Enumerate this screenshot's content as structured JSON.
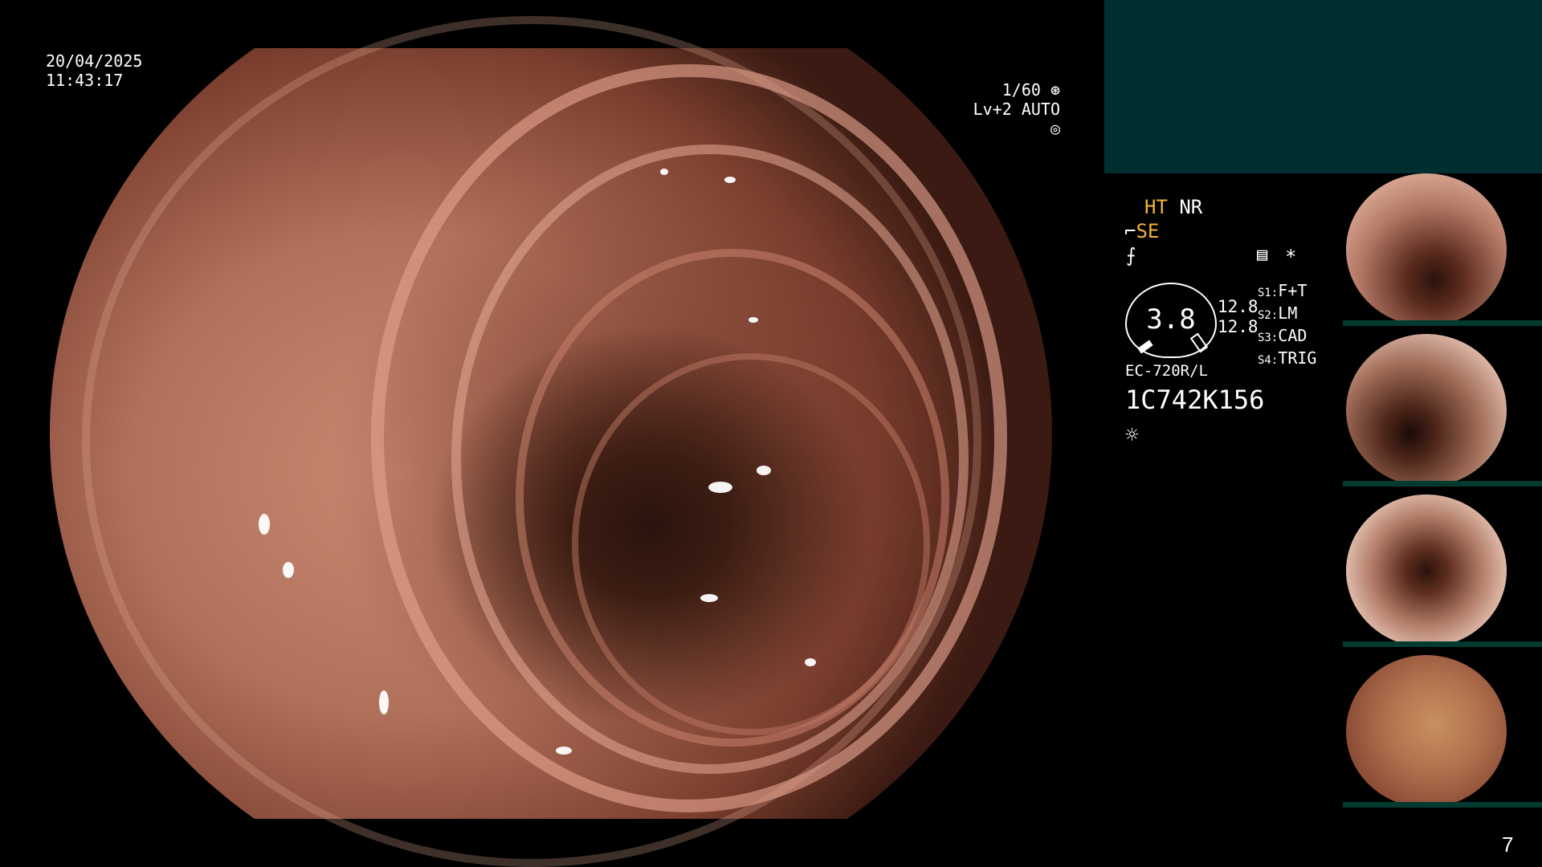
{
  "osd": {
    "date": "20/04/2025",
    "time": "11:43:17",
    "shutter": "1/60",
    "level": "Lv+2 AUTO"
  },
  "status": {
    "ht": "HT",
    "nr": "NR",
    "se": "SE",
    "gauge_value": "3.8",
    "gauge_right_1": "12.8",
    "gauge_right_2": "12.8",
    "scope_model": "EC-720R/L",
    "serial": "1C742K156",
    "asterisk": "*"
  },
  "switches": [
    {
      "key": "S1:",
      "value": "F+T"
    },
    {
      "key": "S2:",
      "value": "LM"
    },
    {
      "key": "S3:",
      "value": "CAD"
    },
    {
      "key": "S4:",
      "value": "TRIG"
    }
  ],
  "page_number": "7",
  "colors": {
    "panel_teal": "#012e2e",
    "accent_yellow": "#f2b233",
    "background": "#000000"
  },
  "icons": [
    "shutter-icon",
    "auto-iris-icon",
    "scope-bend-icon",
    "image-enhance-icon",
    "memory-icon",
    "light-icon"
  ]
}
